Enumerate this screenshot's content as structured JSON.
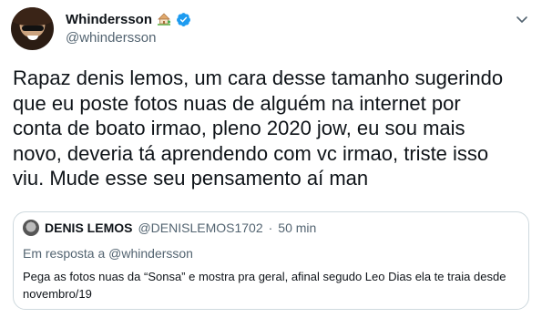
{
  "user": {
    "display_name": "Whindersson",
    "handle": "@whindersson",
    "emoji_icon": "house-with-garden",
    "verified": true
  },
  "tweet": {
    "text": "Rapaz denis lemos, um cara desse tamanho sugerindo\nque eu poste fotos nuas de alguém na internet por\nconta de boato irmao, pleno 2020 jow, eu sou mais\nnovo, deveria tá aprendendo com vc irmao, triste isso\nviu. Mude esse seu pensamento aí man"
  },
  "quoted_tweet": {
    "display_name": "DENIS LEMOS",
    "handle": "@DENISLEMOS1702",
    "separator": "·",
    "time": "50 min",
    "reply_prefix": "Em resposta a",
    "reply_to": "@whindersson",
    "text": "Pega as fotos nuas da “Sonsa” e mostra pra geral, afinal segudo Leo Dias ela te traia desde novembro/19"
  },
  "colors": {
    "verified_blue": "#1d9bf0",
    "secondary_text": "#536471",
    "border": "#cfd9de"
  }
}
